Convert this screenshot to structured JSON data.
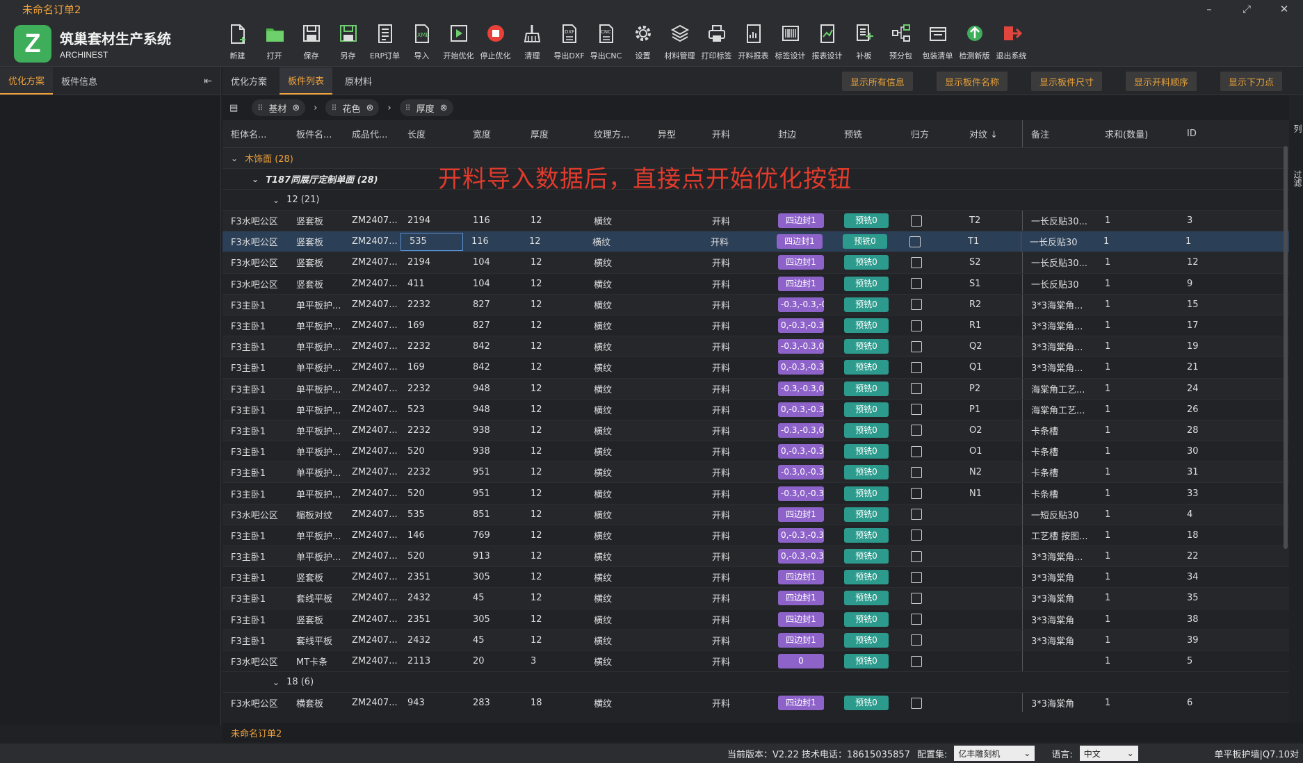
{
  "window": {
    "title": "未命名订单2",
    "controls": [
      "–",
      "⤢",
      "✕"
    ]
  },
  "brand": {
    "logo_letter": "Z",
    "name": "筑巢套材生产系统",
    "subtitle": "ARCHINEST",
    "color": "#3fae5a"
  },
  "toolbar": [
    {
      "label": "新建",
      "icon": "new-file-icon"
    },
    {
      "label": "打开",
      "icon": "folder-icon"
    },
    {
      "label": "保存",
      "icon": "save-icon"
    },
    {
      "label": "另存",
      "icon": "save-as-icon"
    },
    {
      "label": "ERP订单",
      "icon": "erp-icon"
    },
    {
      "label": "导入",
      "icon": "xml-import-icon"
    },
    {
      "label": "开始优化",
      "icon": "play-icon"
    },
    {
      "label": "停止优化",
      "icon": "stop-icon"
    },
    {
      "label": "清理",
      "icon": "broom-icon"
    },
    {
      "label": "导出DXF",
      "icon": "dxf-icon"
    },
    {
      "label": "导出CNC",
      "icon": "cnc-icon"
    },
    {
      "label": "设置",
      "icon": "gear-icon"
    },
    {
      "label": "材料管理",
      "icon": "layers-icon"
    },
    {
      "label": "打印标签",
      "icon": "printer-icon"
    },
    {
      "label": "开料报表",
      "icon": "report-icon"
    },
    {
      "label": "标签设计",
      "icon": "barcode-icon"
    },
    {
      "label": "报表设计",
      "icon": "chart-icon"
    },
    {
      "label": "补板",
      "icon": "patch-icon"
    },
    {
      "label": "预分包",
      "icon": "tree-icon"
    },
    {
      "label": "包装清单",
      "icon": "box-icon"
    },
    {
      "label": "检测新版",
      "icon": "update-icon"
    },
    {
      "label": "退出系统",
      "icon": "exit-icon"
    }
  ],
  "left_panel": {
    "tabs": [
      "优化方案",
      "板件信息"
    ],
    "active_tab": 0,
    "collapse_icon": "⇤"
  },
  "main_tabs": {
    "tabs": [
      "优化方案",
      "板件列表",
      "原材料"
    ],
    "active_tab": 1
  },
  "show_buttons": [
    "显示所有信息",
    "显示板件名称",
    "显示板件尺寸",
    "显示开料顺序",
    "显示下刀点"
  ],
  "filters": {
    "icon": "▤",
    "chips": [
      "基材",
      "花色",
      "厚度"
    ]
  },
  "table": {
    "columns": [
      "柜体名...",
      "板件名...",
      "成品代...",
      "长度",
      "宽度",
      "厚度",
      "纹理方...",
      "异型",
      "开料",
      "封边",
      "预铣",
      "归方",
      "对纹 ↓",
      "备注",
      "求和(数量)",
      "ID"
    ],
    "groups": {
      "level1": "木饰面 (28)",
      "level2": "T187同展厅定制单面 (28)",
      "level3a": "12 (21)",
      "level3b": "18 (6)"
    },
    "rows": [
      {
        "c": [
          "F3水吧公区",
          "竖套板",
          "ZM2407...",
          "2194",
          "116",
          "12",
          "横纹",
          "",
          "开料",
          "四边封1",
          "预铣0",
          "",
          "T2",
          "一长反贴30...",
          "1",
          "3"
        ]
      },
      {
        "c": [
          "F3水吧公区",
          "竖套板",
          "ZM2407...",
          "535",
          "116",
          "12",
          "横纹",
          "",
          "开料",
          "四边封1",
          "预铣0",
          "",
          "T1",
          "一长反贴30",
          "1",
          "1"
        ],
        "selected": true
      },
      {
        "c": [
          "F3水吧公区",
          "竖套板",
          "ZM2407...",
          "2194",
          "104",
          "12",
          "横纹",
          "",
          "开料",
          "四边封1",
          "预铣0",
          "",
          "S2",
          "一长反贴30...",
          "1",
          "12"
        ]
      },
      {
        "c": [
          "F3水吧公区",
          "竖套板",
          "ZM2407...",
          "411",
          "104",
          "12",
          "横纹",
          "",
          "开料",
          "四边封1",
          "预铣0",
          "",
          "S1",
          "一长反贴30",
          "1",
          "9"
        ]
      },
      {
        "c": [
          "F3主卧1",
          "单平板护...",
          "ZM2407...",
          "2232",
          "827",
          "12",
          "横纹",
          "",
          "开料",
          "-0.3,-0.3,-0",
          "预铣0",
          "",
          "R2",
          "3*3海棠角...",
          "1",
          "15"
        ]
      },
      {
        "c": [
          "F3主卧1",
          "单平板护...",
          "ZM2407...",
          "169",
          "827",
          "12",
          "横纹",
          "",
          "开料",
          "0,-0.3,-0.3,",
          "预铣0",
          "",
          "R1",
          "3*3海棠角...",
          "1",
          "17"
        ]
      },
      {
        "c": [
          "F3主卧1",
          "单平板护...",
          "ZM2407...",
          "2232",
          "842",
          "12",
          "横纹",
          "",
          "开料",
          "-0.3,-0.3,0,",
          "预铣0",
          "",
          "Q2",
          "3*3海棠角...",
          "1",
          "19"
        ]
      },
      {
        "c": [
          "F3主卧1",
          "单平板护...",
          "ZM2407...",
          "169",
          "842",
          "12",
          "横纹",
          "",
          "开料",
          "0,-0.3,-0.3,",
          "预铣0",
          "",
          "Q1",
          "3*3海棠角...",
          "1",
          "21"
        ]
      },
      {
        "c": [
          "F3主卧1",
          "单平板护...",
          "ZM2407...",
          "2232",
          "948",
          "12",
          "横纹",
          "",
          "开料",
          "-0.3,-0.3,0,",
          "预铣0",
          "",
          "P2",
          "海棠角工艺...",
          "1",
          "24"
        ]
      },
      {
        "c": [
          "F3主卧1",
          "单平板护...",
          "ZM2407...",
          "523",
          "948",
          "12",
          "横纹",
          "",
          "开料",
          "0,-0.3,-0.3,",
          "预铣0",
          "",
          "P1",
          "海棠角工艺...",
          "1",
          "26"
        ]
      },
      {
        "c": [
          "F3主卧1",
          "单平板护...",
          "ZM2407...",
          "2232",
          "938",
          "12",
          "横纹",
          "",
          "开料",
          "-0.3,-0.3,0,",
          "预铣0",
          "",
          "O2",
          "卡条槽",
          "1",
          "28"
        ]
      },
      {
        "c": [
          "F3主卧1",
          "单平板护...",
          "ZM2407...",
          "520",
          "938",
          "12",
          "横纹",
          "",
          "开料",
          "0,-0.3,-0.3,",
          "预铣0",
          "",
          "O1",
          "卡条槽",
          "1",
          "30"
        ]
      },
      {
        "c": [
          "F3主卧1",
          "单平板护...",
          "ZM2407...",
          "2232",
          "951",
          "12",
          "横纹",
          "",
          "开料",
          "-0.3,0,-0.3,",
          "预铣0",
          "",
          "N2",
          "卡条槽",
          "1",
          "31"
        ]
      },
      {
        "c": [
          "F3主卧1",
          "单平板护...",
          "ZM2407...",
          "520",
          "951",
          "12",
          "横纹",
          "",
          "开料",
          "-0.3,0,-0.3,",
          "预铣0",
          "",
          "N1",
          "卡条槽",
          "1",
          "33"
        ]
      },
      {
        "c": [
          "F3水吧公区",
          "楣板对纹",
          "ZM2407...",
          "535",
          "851",
          "12",
          "横纹",
          "",
          "开料",
          "四边封1",
          "预铣0",
          "",
          "",
          "一短反贴30",
          "1",
          "4"
        ]
      },
      {
        "c": [
          "F3主卧1",
          "单平板护...",
          "ZM2407...",
          "146",
          "769",
          "12",
          "横纹",
          "",
          "开料",
          "0,-0.3,-0.3,",
          "预铣0",
          "",
          "",
          "工艺槽 按图...",
          "1",
          "18"
        ]
      },
      {
        "c": [
          "F3主卧1",
          "单平板护...",
          "ZM2407...",
          "520",
          "913",
          "12",
          "横纹",
          "",
          "开料",
          "0,-0.3,-0.3,",
          "预铣0",
          "",
          "",
          "3*3海棠角...",
          "1",
          "22"
        ]
      },
      {
        "c": [
          "F3主卧1",
          "竖套板",
          "ZM2407...",
          "2351",
          "305",
          "12",
          "横纹",
          "",
          "开料",
          "四边封1",
          "预铣0",
          "",
          "",
          "3*3海棠角",
          "1",
          "34"
        ]
      },
      {
        "c": [
          "F3主卧1",
          "套线平板",
          "ZM2407...",
          "2432",
          "45",
          "12",
          "横纹",
          "",
          "开料",
          "四边封1",
          "预铣0",
          "",
          "",
          "3*3海棠角",
          "1",
          "35"
        ]
      },
      {
        "c": [
          "F3主卧1",
          "竖套板",
          "ZM2407...",
          "2351",
          "305",
          "12",
          "横纹",
          "",
          "开料",
          "四边封1",
          "预铣0",
          "",
          "",
          "3*3海棠角",
          "1",
          "38"
        ]
      },
      {
        "c": [
          "F3主卧1",
          "套线平板",
          "ZM2407...",
          "2432",
          "45",
          "12",
          "横纹",
          "",
          "开料",
          "四边封1",
          "预铣0",
          "",
          "",
          "3*3海棠角",
          "1",
          "39"
        ]
      },
      {
        "c": [
          "F3水吧公区",
          "MT卡条",
          "ZM2407...",
          "2113",
          "20",
          "3",
          "横纹",
          "",
          "开料",
          "0",
          "预铣0",
          "",
          "",
          "",
          "1",
          "5"
        ]
      }
    ],
    "rows_18": [
      {
        "c": [
          "F3水吧公区",
          "横套板",
          "ZM2407...",
          "943",
          "283",
          "18",
          "横纹",
          "",
          "开料",
          "四边封1",
          "预铣0",
          "",
          "",
          "3*3海棠角",
          "1",
          "6"
        ]
      }
    ]
  },
  "annotation": "开料导入数据后，直接点开始优化按钮",
  "right_strip": {
    "top": "列",
    "bottom": "过滤"
  },
  "order_name": "未命名订单2",
  "status": {
    "version": "当前版本：V2.22 技术电话：18615035857",
    "config_label": "配置集:",
    "config_value": "亿丰雕刻机",
    "lang_label": "语言:",
    "lang_value": "中文",
    "right_text": "单平板护墙|Q7.10对"
  },
  "colors": {
    "accent": "#f0a23b",
    "edge_pill": "#8e63c9",
    "mill_pill": "#2c9a8c",
    "selected_row": "#2b3f57",
    "annotation": "#e03b2c"
  }
}
